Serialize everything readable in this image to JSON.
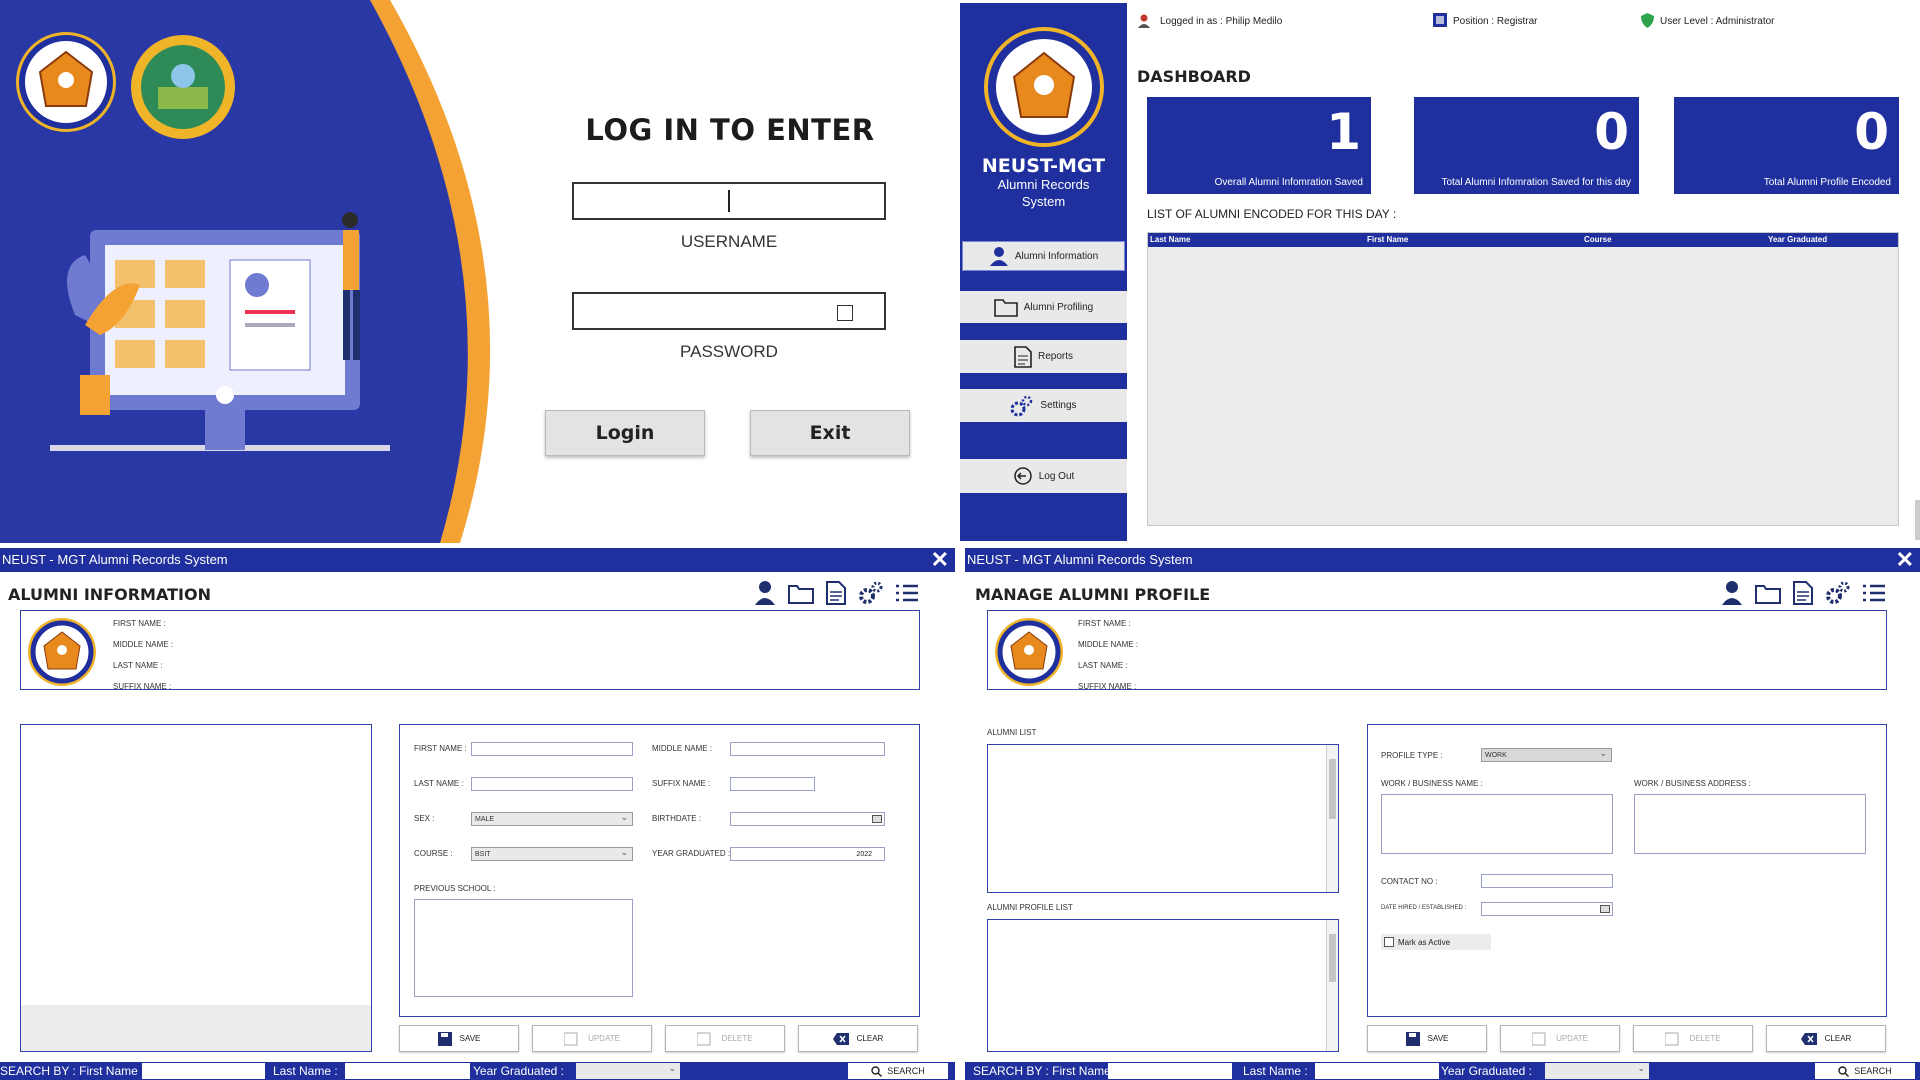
{
  "login": {
    "title": "LOG IN TO ENTER",
    "username_label": "USERNAME",
    "password_label": "PASSWORD",
    "login_button": "Login",
    "exit_button": "Exit"
  },
  "dashboard": {
    "header": {
      "logged_in": "Logged in as : Philip Medilo",
      "position": "Position : Registrar",
      "user_level": "User Level : Administrator"
    },
    "brand": {
      "name": "NEUST-MGT",
      "line1": "Alumni Records",
      "line2": "System"
    },
    "sidebar": [
      {
        "label": "Alumni Information",
        "icon": "user-icon"
      },
      {
        "label": "Alumni Profiling",
        "icon": "folder-icon"
      },
      {
        "label": "Reports",
        "icon": "document-icon"
      },
      {
        "label": "Settings",
        "icon": "gears-icon"
      },
      {
        "label": "Log Out",
        "icon": "logout-icon"
      }
    ],
    "title": "DASHBOARD",
    "cards": [
      {
        "value": "1",
        "caption": "Overall Alumni Infomration Saved"
      },
      {
        "value": "0",
        "caption": "Total Alumni Infomration Saved for this day"
      },
      {
        "value": "0",
        "caption": "Total Alumni Profile Encoded"
      }
    ],
    "list_title": "LIST OF ALUMNI ENCODED FOR THIS DAY :",
    "columns": [
      "Last Name",
      "First Name",
      "Course",
      "Year Graduated"
    ]
  },
  "alumni_info": {
    "window_title": "NEUST - MGT Alumni Records System",
    "page_title": "ALUMNI INFORMATION",
    "summary_labels": [
      "FIRST NAME :",
      "MIDDLE NAME :",
      "LAST NAME :",
      "SUFFIX NAME :"
    ],
    "form": {
      "first_name": "FIRST NAME :",
      "middle_name": "MIDDLE NAME :",
      "last_name": "LAST NAME :",
      "suffix_name": "SUFFIX NAME :",
      "sex": "SEX :",
      "sex_value": "MALE",
      "birthdate": "BIRTHDATE :",
      "course": "COURSE :",
      "course_value": "BSIT",
      "year_graduated": "YEAR GRADUATED :",
      "year_value": "2022",
      "previous_school": "PREVIOUS SCHOOL :"
    },
    "actions": [
      "SAVE",
      "UPDATE",
      "DELETE",
      "CLEAR"
    ],
    "search": {
      "first": "SEARCH BY : First Name :",
      "last": "Last Name :",
      "year": "Year Graduated :",
      "button": "SEARCH"
    }
  },
  "alumni_profile": {
    "window_title": "NEUST - MGT Alumni Records System",
    "page_title": "MANAGE ALUMNI PROFILE",
    "summary_labels": [
      "FIRST NAME :",
      "MIDDLE NAME :",
      "LAST NAME :",
      "SUFFIX NAME :"
    ],
    "alumni_list": "ALUMNI LIST",
    "alumni_profile_list": "ALUMNI PROFILE LIST",
    "form": {
      "profile_type": "PROFILE TYPE :",
      "profile_type_value": "WORK",
      "work_name": "WORK / BUSINESS NAME :",
      "work_address": "WORK / BUSINESS ADDRESS :",
      "contact": "CONTACT NO :",
      "date_hired": "DATE HIRED / ESTABLISHED :",
      "mark_active": "Mark as Active"
    },
    "actions": [
      "SAVE",
      "UPDATE",
      "DELETE",
      "CLEAR"
    ],
    "search": {
      "first": "SEARCH BY : First Name :",
      "last": "Last Name :",
      "year": "Year Graduated :",
      "button": "SEARCH"
    }
  },
  "colors": {
    "navy": "#1f2f9e",
    "orange": "#f4a234",
    "panel_gray": "#e9e9e9"
  }
}
